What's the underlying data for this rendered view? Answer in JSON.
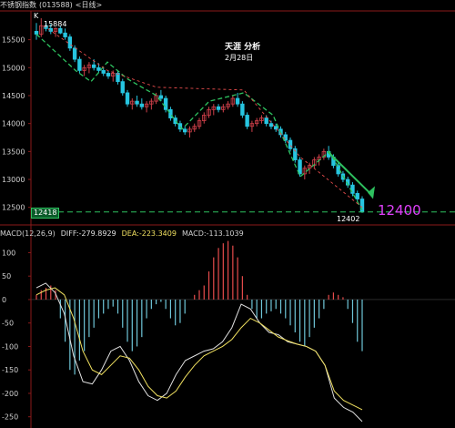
{
  "title_bar": {
    "name": "不锈钢指数",
    "code": "(013588)",
    "period": "<日线>"
  },
  "k_marker": "K",
  "high_label": "15884",
  "low_label": "12402",
  "current_price_box": "12418",
  "big_price": "12400",
  "annotation": {
    "author": "天涯 分析",
    "date": "2月28日"
  },
  "price_axis": {
    "ticks": [
      "15500",
      "15000",
      "14500",
      "14000",
      "13500",
      "13000",
      "12500"
    ]
  },
  "macd_header": {
    "params": "MACD(12,26,9)",
    "diff": "DIFF:-279.8929",
    "dea": "DEA:-223.3409",
    "macd": "MACD:-113.1039"
  },
  "macd_axis": {
    "ticks": [
      "100",
      "50",
      "0",
      "-50",
      "-100",
      "-150",
      "-200",
      "-250"
    ]
  },
  "colors": {
    "up": "#27c5e0",
    "down": "#27c5e0",
    "up_hist": "#e74c4c",
    "down_hist": "#6fc6d8",
    "diff": "#e0e0e0",
    "dea": "#f0e060",
    "trend": "#2ec15f",
    "dashed": "#2ec15f",
    "redline": "#e74c4c"
  },
  "chart_data": {
    "type": "candlestick",
    "price_range": [
      12300,
      15950
    ],
    "candles": [
      [
        15650,
        15800,
        15500,
        15600
      ],
      [
        15600,
        15884,
        15550,
        15750
      ],
      [
        15750,
        15800,
        15650,
        15700
      ],
      [
        15700,
        15780,
        15600,
        15650
      ],
      [
        15650,
        15720,
        15550,
        15700
      ],
      [
        15700,
        15750,
        15600,
        15620
      ],
      [
        15620,
        15700,
        15500,
        15550
      ],
      [
        15550,
        15600,
        15300,
        15350
      ],
      [
        15350,
        15400,
        15100,
        15150
      ],
      [
        15150,
        15200,
        14900,
        14950
      ],
      [
        14950,
        15050,
        14850,
        15000
      ],
      [
        15000,
        15100,
        14900,
        15050
      ],
      [
        15050,
        15150,
        14950,
        15000
      ],
      [
        15000,
        15080,
        14900,
        14950
      ],
      [
        14950,
        15000,
        14850,
        14900
      ],
      [
        14900,
        14950,
        14800,
        14850
      ],
      [
        14850,
        14950,
        14750,
        14900
      ],
      [
        14900,
        14950,
        14700,
        14750
      ],
      [
        14750,
        14800,
        14500,
        14550
      ],
      [
        14550,
        14600,
        14300,
        14350
      ],
      [
        14350,
        14450,
        14250,
        14400
      ],
      [
        14400,
        14500,
        14300,
        14350
      ],
      [
        14350,
        14450,
        14250,
        14300
      ],
      [
        14300,
        14400,
        14200,
        14350
      ],
      [
        14350,
        14450,
        14250,
        14400
      ],
      [
        14400,
        14550,
        14350,
        14500
      ],
      [
        14500,
        14600,
        14400,
        14450
      ],
      [
        14450,
        14500,
        14200,
        14250
      ],
      [
        14250,
        14300,
        14050,
        14100
      ],
      [
        14100,
        14150,
        13950,
        14000
      ],
      [
        14000,
        14050,
        13850,
        13900
      ],
      [
        13900,
        13950,
        13800,
        13850
      ],
      [
        13850,
        13950,
        13750,
        13900
      ],
      [
        13900,
        14000,
        13850,
        13950
      ],
      [
        13950,
        14100,
        13900,
        14050
      ],
      [
        14050,
        14200,
        14000,
        14150
      ],
      [
        14150,
        14300,
        14100,
        14250
      ],
      [
        14250,
        14350,
        14150,
        14300
      ],
      [
        14300,
        14350,
        14200,
        14250
      ],
      [
        14250,
        14350,
        14200,
        14300
      ],
      [
        14300,
        14400,
        14250,
        14350
      ],
      [
        14350,
        14500,
        14300,
        14450
      ],
      [
        14450,
        14550,
        14300,
        14350
      ],
      [
        14350,
        14400,
        14100,
        14150
      ],
      [
        14150,
        14200,
        13900,
        13950
      ],
      [
        13950,
        14050,
        13850,
        14000
      ],
      [
        14000,
        14100,
        13950,
        14050
      ],
      [
        14050,
        14150,
        14000,
        14100
      ],
      [
        14100,
        14150,
        13950,
        14000
      ],
      [
        14000,
        14050,
        13900,
        13950
      ],
      [
        13950,
        14000,
        13850,
        13900
      ],
      [
        13900,
        13950,
        13750,
        13800
      ],
      [
        13800,
        13850,
        13650,
        13700
      ],
      [
        13700,
        13750,
        13500,
        13550
      ],
      [
        13550,
        13600,
        13300,
        13350
      ],
      [
        13350,
        13400,
        13050,
        13100
      ],
      [
        13100,
        13250,
        13000,
        13200
      ],
      [
        13200,
        13300,
        13100,
        13250
      ],
      [
        13250,
        13400,
        13200,
        13350
      ],
      [
        13350,
        13450,
        13250,
        13400
      ],
      [
        13400,
        13550,
        13350,
        13500
      ],
      [
        13500,
        13600,
        13350,
        13400
      ],
      [
        13400,
        13450,
        13200,
        13250
      ],
      [
        13250,
        13300,
        13050,
        13100
      ],
      [
        13100,
        13150,
        12950,
        13000
      ],
      [
        13000,
        13050,
        12850,
        12900
      ],
      [
        12900,
        12950,
        12700,
        12750
      ],
      [
        12750,
        12800,
        12600,
        12650
      ],
      [
        12650,
        12700,
        12402,
        12418
      ]
    ]
  }
}
